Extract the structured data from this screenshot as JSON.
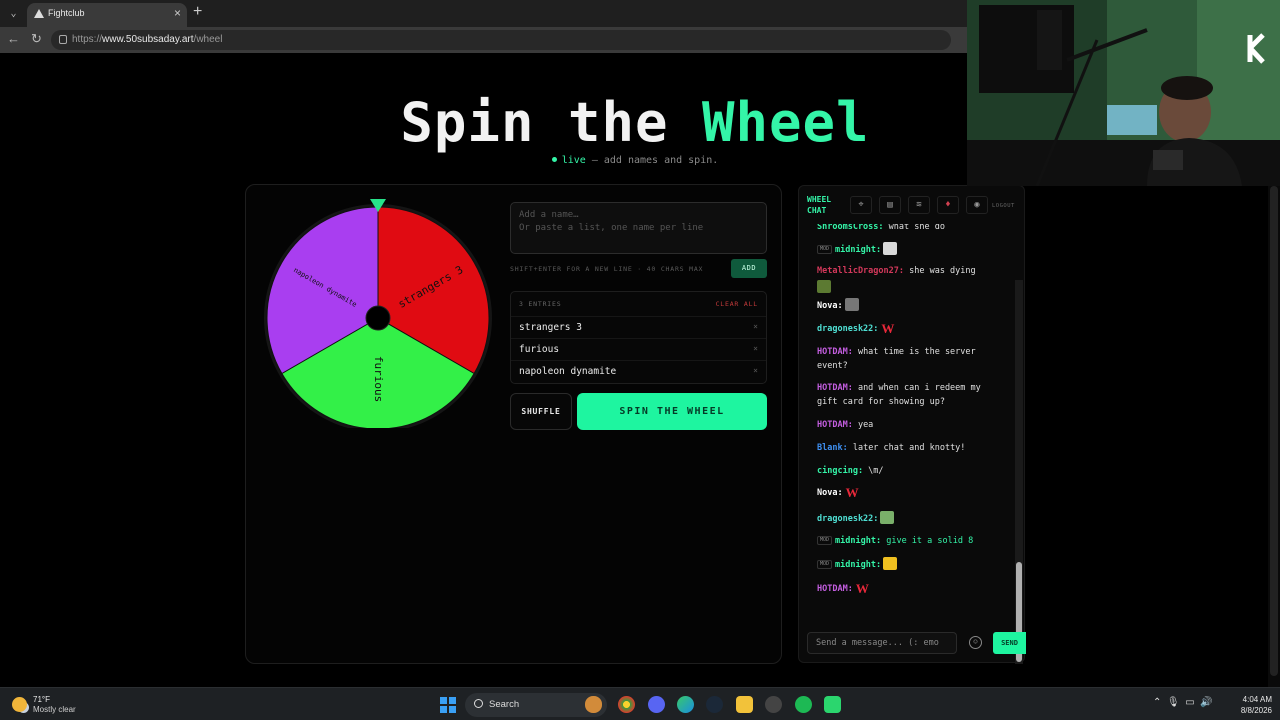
{
  "browser": {
    "tab_title": "Fightclub",
    "url_prefix": "https://",
    "url_host": "www.50subsaday.art",
    "url_path": "/wheel"
  },
  "page": {
    "title_main": "Spin the ",
    "title_accent": "Wheel",
    "subtitle_live": "live",
    "subtitle_rest": " — add names and spin."
  },
  "wheel": {
    "segments": [
      {
        "label": "strangers 3",
        "color": "#e00b12"
      },
      {
        "label": "furious",
        "color": "#33f048"
      },
      {
        "label": "napoleon dynamite",
        "color": "#a93ef0"
      }
    ],
    "pointer_color": "#27e28a"
  },
  "form": {
    "placeholder": "Add a name…\nOr paste a list, one name per line",
    "hint": "SHIFT+ENTER FOR A NEW LINE · 40 CHARS MAX",
    "add_label": "ADD",
    "entries_count": "3 ENTRIES",
    "clear_all": "CLEAR ALL",
    "entries": [
      "strangers 3",
      "furious",
      "napoleon dynamite"
    ],
    "remove_glyph": "×",
    "shuffle_label": "SHUFFLE",
    "spin_label": "SPIN THE WHEEL"
  },
  "chat": {
    "title_line1": "WHEEL",
    "title_line2": "CHAT",
    "logout": "LOGOUT",
    "input_placeholder": "Send a message... (: emo",
    "send_label": "SEND",
    "mod_badge": "MOD",
    "messages": [
      {
        "user": "ShroomsCross:",
        "color": "#34f5a8",
        "text": "what she do",
        "mod": false
      },
      {
        "user": "midnight:",
        "color": "#34f5a8",
        "text": "",
        "mod": true,
        "emote": "#d9d9d9"
      },
      {
        "user": "MetallicDragon27:",
        "color": "#d2385a",
        "text": "she was dying",
        "mod": false,
        "emote": "#5c7a32"
      },
      {
        "user": "Nova:",
        "color": "#ffffff",
        "text": "",
        "mod": false,
        "emote": "#777777"
      },
      {
        "user": "dragonesk22:",
        "color": "#4fe0d4",
        "text": "",
        "mod": false,
        "w": true
      },
      {
        "user": "HOTDAM:",
        "color": "#c45ee0",
        "text": "what time is the server event?",
        "mod": false
      },
      {
        "user": "HOTDAM:",
        "color": "#c45ee0",
        "text": "and when can i redeem my gift card for showing up?",
        "mod": false
      },
      {
        "user": "HOTDAM:",
        "color": "#c45ee0",
        "text": "yea",
        "mod": false
      },
      {
        "user": "Blank:",
        "color": "#3e8ff0",
        "text": "later chat and knotty!",
        "mod": false
      },
      {
        "user": "cingcing:",
        "color": "#34f5a8",
        "text": "\\m/",
        "mod": false
      },
      {
        "user": "Nova:",
        "color": "#ffffff",
        "text": "",
        "mod": false,
        "w": true
      },
      {
        "user": "dragonesk22:",
        "color": "#4fe0d4",
        "text": "",
        "mod": false,
        "emote": "#7ab06a"
      },
      {
        "user": "midnight:",
        "color": "#34f5a8",
        "text": "give it a solid 8",
        "mod": true,
        "textcolor": "#34f5a8"
      },
      {
        "user": "midnight:",
        "color": "#34f5a8",
        "text": "",
        "mod": true,
        "emote": "#f0c020"
      },
      {
        "user": "HOTDAM:",
        "color": "#c45ee0",
        "text": "",
        "mod": false,
        "w": true
      }
    ],
    "w_glyph": "W"
  },
  "taskbar": {
    "temp": "71°F",
    "weather": "Mostly clear",
    "search": "Search",
    "time": "4:04 AM",
    "date": "8/8/2026"
  },
  "colors": {
    "accent": "#34f5a8"
  }
}
